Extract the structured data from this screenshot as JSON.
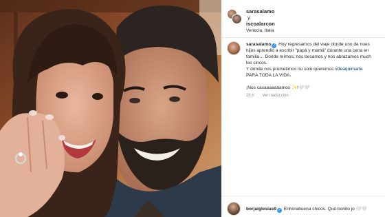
{
  "post": {
    "header": {
      "user1": "sarasalamo",
      "separator": "y",
      "user2": "iscoalarcon",
      "location": "Venecia, Italia"
    },
    "caption": {
      "username": "sarasalamo",
      "line1": "Hoy regresamos del viaje donde uno de nues",
      "line2": "hijos aprendió a escribir \"papá y mamá\" durante una cena en",
      "line3": "familia… Donde reímos, nos besamos y nos abrazamos much",
      "line4": "los cincos.",
      "line5_prefix": "Y dónde nos prometimos no solo queremos ",
      "line5_tag": "#deaquimarte",
      "line6": "PARA TODA LA VIDA.",
      "line7": "¡Nos casaaaaaaamos ✨!🤍🤍"
    },
    "meta": {
      "time": "16 h",
      "translate": "Ver traducción"
    },
    "comment": {
      "username": "borjaiglesias9",
      "text": "Enhorabuena chicos. Qué bonito jo 🤍🤍"
    }
  },
  "colors": {
    "verified": "#3897f0",
    "hashtag": "#00376b",
    "muted": "#8e8e8e"
  }
}
